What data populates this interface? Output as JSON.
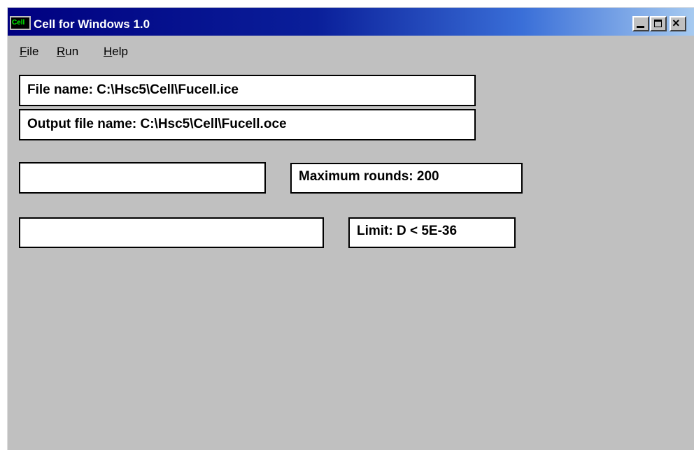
{
  "window": {
    "title": "Cell for Windows 1.0",
    "icon_label": "Cell"
  },
  "menu": {
    "file": {
      "first": "F",
      "rest": "ile"
    },
    "run": {
      "first": "R",
      "rest": "un"
    },
    "help": {
      "first": "H",
      "rest": "elp"
    }
  },
  "fields": {
    "file_name": "File name:  C:\\Hsc5\\Cell\\Fucell.ice",
    "output_file_name": "Output file name:  C:\\Hsc5\\Cell\\Fucell.oce",
    "blank_1": "",
    "maximum_rounds": "Maximum rounds: 200",
    "blank_2": "",
    "limit": "Limit: D < 5E-36"
  },
  "colors": {
    "window_bg": "#c0c0c0",
    "title_bar_start": "#000080",
    "title_bar_end": "#a6caf0",
    "field_bg": "#ffffff"
  },
  "icons": {
    "app": "cell-app-icon",
    "minimize": "minimize-icon",
    "maximize": "maximize-icon",
    "close": "close-icon"
  }
}
